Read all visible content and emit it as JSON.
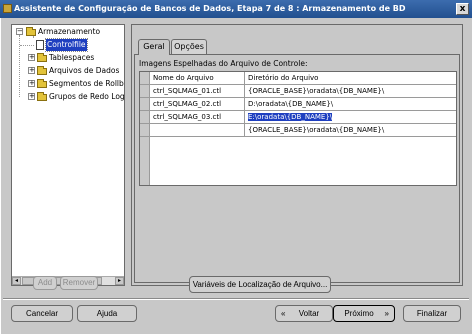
{
  "window": {
    "title": "Assistente de Configuração de Bancos de Dados, Etapa 7 de 8 : Armazenamento de BD",
    "close_symbol": "x"
  },
  "tree": {
    "root": "Armazenamento",
    "items": [
      {
        "label": "Controlfile",
        "selected": true
      },
      {
        "label": "Tablespaces"
      },
      {
        "label": "Arquivos de Dados"
      },
      {
        "label": "Segmentos de Rollback"
      },
      {
        "label": "Grupos de Redo Logs"
      }
    ],
    "toggle_collapsed": "+",
    "toggle_expanded": "−",
    "scroll_left": "◂",
    "scroll_right": "▸"
  },
  "tree_buttons": {
    "add": "Add",
    "remove": "Remover"
  },
  "tabs": [
    {
      "label": "Geral",
      "active": true
    },
    {
      "label": "Opções",
      "active": false
    }
  ],
  "grid": {
    "caption": "Imagens Espelhadas do Arquivo de Controle:",
    "columns": [
      "Nome do Arquivo",
      "Diretório do Arquivo"
    ],
    "rows": [
      [
        "ctrl_SQLMAG_01.ctl",
        "{ORACLE_BASE}\\oradata\\{DB_NAME}\\"
      ],
      [
        "ctrl_SQLMAG_02.ctl",
        "D:\\oradata\\{DB_NAME}\\"
      ],
      [
        "ctrl_SQLMAG_03.ctl",
        "E:\\oradata\\{DB_NAME}\\"
      ],
      [
        "",
        "{ORACLE_BASE}\\oradata\\{DB_NAME}\\"
      ]
    ]
  },
  "location_vars_button": "Variáveis de Localização de Arquivo...",
  "footer": {
    "cancel": "Cancelar",
    "help": "Ajuda",
    "back": "Voltar",
    "next": "Próximo",
    "finish": "Finalizar",
    "back_arrow": "«",
    "next_arrow": "»"
  }
}
